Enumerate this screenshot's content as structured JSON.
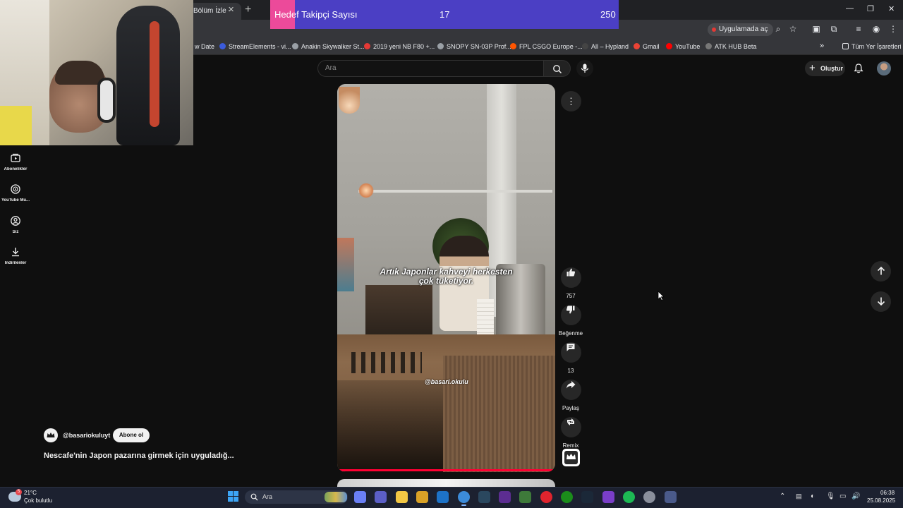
{
  "browser": {
    "tab_title": "Bölüm İzle -",
    "open_in_app": "Uygulamada aç",
    "bookmarks": [
      {
        "label": "w Date",
        "icon": "page-icon",
        "color": "#5f6368"
      },
      {
        "label": "StreamElements - vi...",
        "icon": "streamelements-icon",
        "color": "#3b5bdb"
      },
      {
        "label": "Anakin Skywalker St...",
        "icon": "globe-icon",
        "color": "#9aa0a6"
      },
      {
        "label": "2019 yeni NB F80 +...",
        "icon": "aliexpress-icon",
        "color": "#e53935"
      },
      {
        "label": "SNOPY SN-03P Prof...",
        "icon": "globe-icon",
        "color": "#9aa0a6"
      },
      {
        "label": "FPL CSGO Europe -...",
        "icon": "faceit-icon",
        "color": "#ff5500"
      },
      {
        "label": "All – Hypland",
        "icon": "hypland-icon",
        "color": "#444444"
      },
      {
        "label": "Gmail",
        "icon": "gmail-icon",
        "color": "#ea4335"
      },
      {
        "label": "YouTube",
        "icon": "youtube-icon",
        "color": "#ff0000"
      },
      {
        "label": "ATK HUB Beta",
        "icon": "atk-icon",
        "color": "#777777"
      }
    ],
    "all_bookmarks": "Tüm Yer İşaretleri"
  },
  "overlay": {
    "label": "Hedef Takipçi Sayısı",
    "current": "17",
    "goal": "250"
  },
  "youtube": {
    "search_placeholder": "Ara",
    "create_label": "Oluştur",
    "sidebar": [
      {
        "label": "Abonelikler",
        "icon": "subscriptions-icon"
      },
      {
        "label": "YouTube Mu...",
        "icon": "youtube-music-icon"
      },
      {
        "label": "Siz",
        "icon": "profile-icon"
      },
      {
        "label": "İndirilenler",
        "icon": "download-icon"
      }
    ],
    "short": {
      "caption_line1": "Artık Japonlar kahveyi herkesten",
      "caption_line2": "çok tüketiyor.",
      "watermark": "@basari.okulu",
      "channel": "@basariokuluyt",
      "subscribe_label": "Abone ol",
      "title": "Nescafe'nin Japon pazarına girmek için uyguladığ...",
      "progress": 1.0
    },
    "actions": {
      "like_count": "757",
      "dislike_label": "Beğenme",
      "comment_count": "13",
      "share_label": "Paylaş",
      "remix_label": "Remix"
    }
  },
  "taskbar": {
    "weather_badge": "5",
    "temperature": "21°C",
    "weather_desc": "Çok bulutlu",
    "search_label": "Ara",
    "time": "06:38",
    "date": "25.08.2025",
    "apps": [
      {
        "name": "copilot-icon",
        "color": "#6a7ff5"
      },
      {
        "name": "teams-icon",
        "color": "#5b5fc7"
      },
      {
        "name": "file-explorer-icon",
        "color": "#f2c744"
      },
      {
        "name": "microsoft-store-icon",
        "color": "#d9a227"
      },
      {
        "name": "outlook-icon",
        "color": "#1d73c8"
      },
      {
        "name": "chrome-icon",
        "color": "#3c8bd9"
      },
      {
        "name": "steam-icon",
        "color": "#2a475e"
      },
      {
        "name": "visual-studio-icon",
        "color": "#5c2d91"
      },
      {
        "name": "nvidia-app-icon",
        "color": "#3e7a3a"
      },
      {
        "name": "opera-gx-icon",
        "color": "#e0242e"
      },
      {
        "name": "xbox-icon",
        "color": "#1b8d1b"
      },
      {
        "name": "steam-alt-icon",
        "color": "#1b2838"
      },
      {
        "name": "nzxt-cam-icon",
        "color": "#7a3ec8"
      },
      {
        "name": "spotify-icon",
        "color": "#1db954"
      },
      {
        "name": "settings-icon",
        "color": "#8a8f9c"
      },
      {
        "name": "calculator-icon",
        "color": "#4a5a8a"
      }
    ]
  }
}
